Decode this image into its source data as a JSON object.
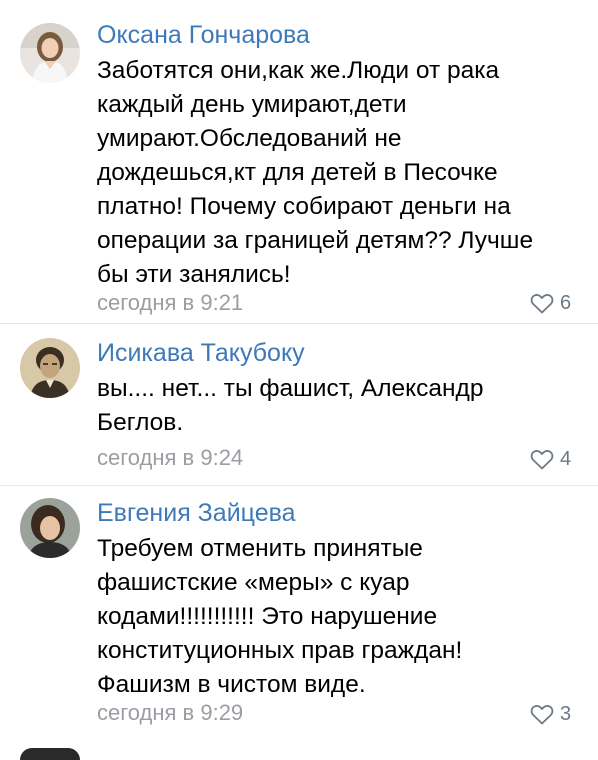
{
  "comments": [
    {
      "author": "Оксана Гончарова",
      "lines": [
        "Заботятся они,как же.Люди от рака",
        "каждый день умирают,дети",
        "умирают.Обследований не",
        "дождешься,кт для детей в Песочке",
        "платно! Почему собирают деньги на",
        "операции за границей детям?? Лучше",
        "бы эти занялись!"
      ],
      "time": "сегодня в 9:21",
      "likes": "6",
      "avatar_icon": "avatar-photo-woman-white"
    },
    {
      "author": "Исикава Такубоку",
      "lines": [
        "вы.... нет... ты фашист, Александр",
        "Беглов."
      ],
      "time": "сегодня в 9:24",
      "likes": "4",
      "avatar_icon": "avatar-photo-man-sepia"
    },
    {
      "author": "Евгения Зайцева",
      "lines": [
        "Требуем отменить принятые",
        "фашистские «меры» с куар",
        "кодами!!!!!!!!!!! Это нарушение",
        "конституционных прав граждан!",
        "Фашизм в чистом виде."
      ],
      "time": "сегодня в 9:29",
      "likes": "3",
      "avatar_icon": "avatar-photo-woman-dark"
    }
  ],
  "colors": {
    "author_link": "#3e79b8",
    "meta_gray": "#9a9ea3",
    "like_icon": "#6d7a86"
  }
}
